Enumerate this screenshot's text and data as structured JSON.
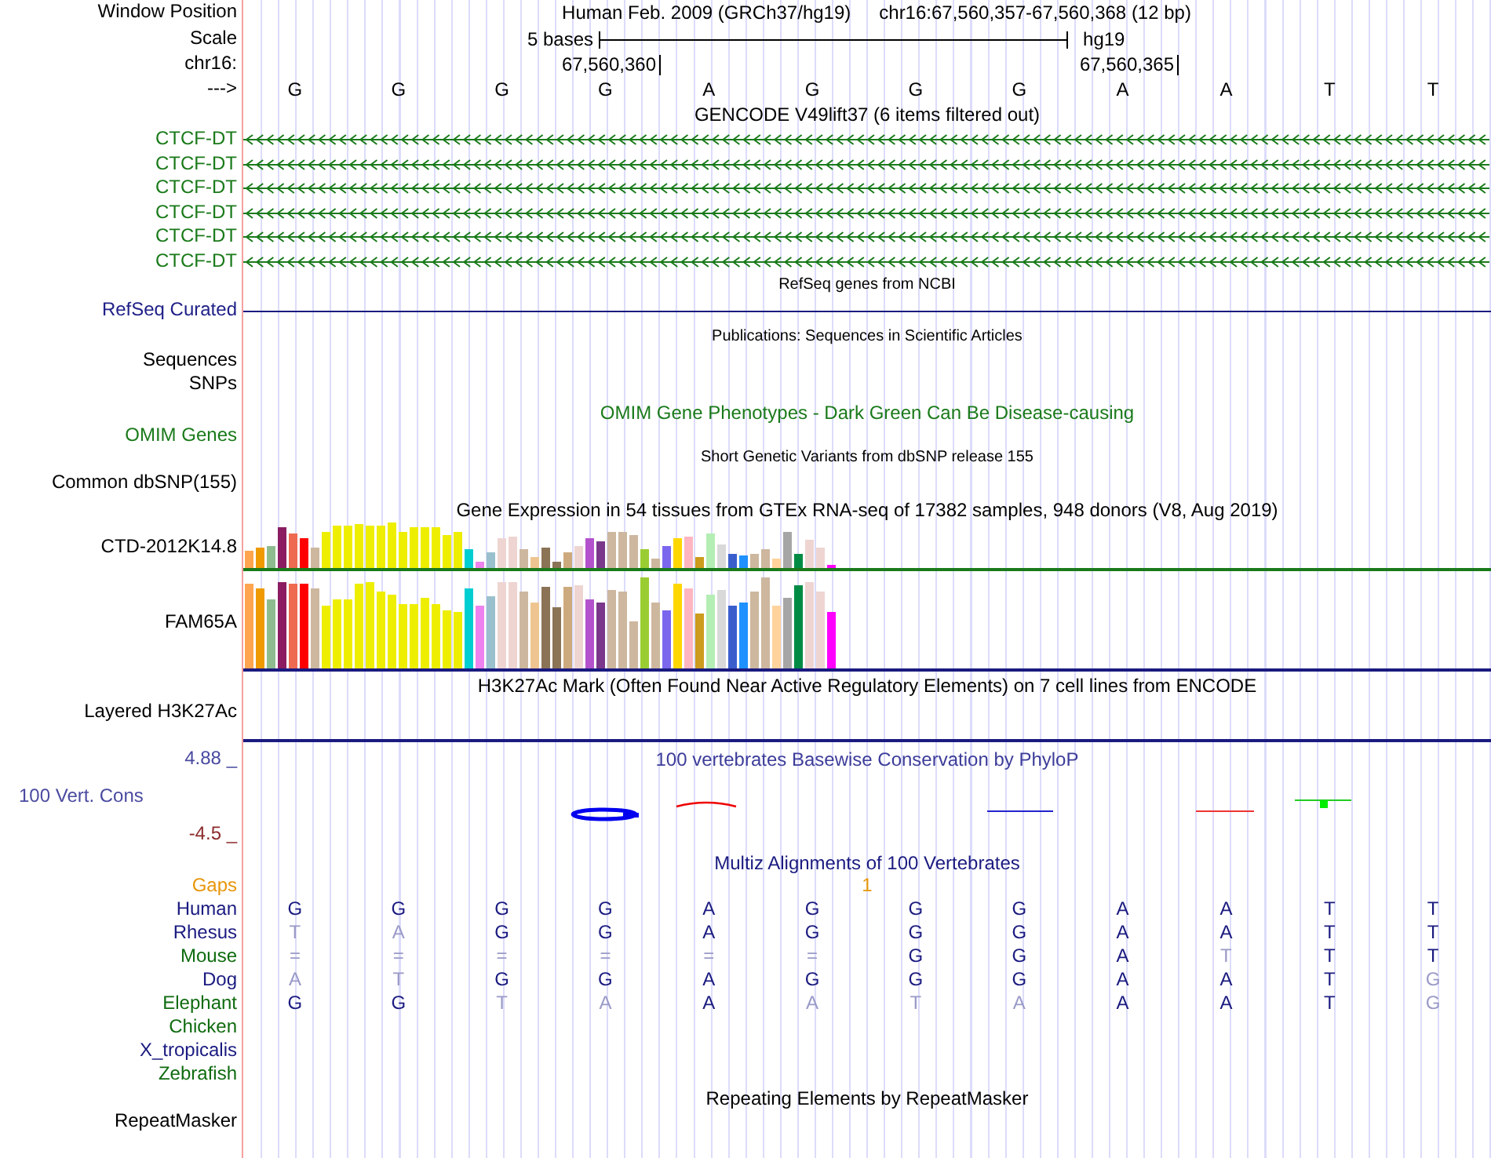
{
  "header": {
    "label": "Window Position",
    "assembly": "Human Feb. 2009 (GRCh37/hg19)",
    "position": "chr16:67,560,357-67,560,368 (12 bp)"
  },
  "scale": {
    "label": "Scale",
    "span": "5 bases",
    "db": "hg19"
  },
  "coords": {
    "label": "chr16:",
    "ticks": [
      "67,560,360",
      "67,560,365"
    ]
  },
  "sequence": {
    "label": "--->",
    "bases": [
      "G",
      "G",
      "G",
      "G",
      "A",
      "G",
      "G",
      "G",
      "A",
      "A",
      "T",
      "T"
    ]
  },
  "gencode": {
    "title": "GENCODE V49lift37 (6 items filtered out)",
    "transcripts": [
      "CTCF-DT",
      "CTCF-DT",
      "CTCF-DT",
      "CTCF-DT",
      "CTCF-DT",
      "CTCF-DT"
    ]
  },
  "refseq": {
    "title": "RefSeq genes from NCBI",
    "label": "RefSeq Curated"
  },
  "publications": {
    "title": "Publications: Sequences in Scientific Articles",
    "labels": [
      "Sequences",
      "SNPs"
    ]
  },
  "omim": {
    "title": "OMIM Gene Phenotypes - Dark Green Can Be Disease-causing",
    "label": "OMIM Genes"
  },
  "dbsnp": {
    "title": "Short Genetic Variants from dbSNP release 155",
    "label": "Common dbSNP(155)"
  },
  "gtex": {
    "title": "Gene Expression in 54 tissues from GTEx RNA-seq of 17382 samples, 948 donors (V8, Aug 2019)",
    "genes": [
      {
        "name": "CTD-2012K14.8",
        "kind": "small"
      },
      {
        "name": "FAM65A",
        "kind": "large"
      }
    ]
  },
  "h3k27ac": {
    "title": "H3K27Ac Mark (Often Found Near Active Regulatory Elements) on 7 cell lines from ENCODE",
    "label": "Layered H3K27Ac"
  },
  "conservation": {
    "title": "100 vertebrates Basewise Conservation by PhyloP",
    "label": "100 Vert. Cons",
    "max": "4.88 _",
    "min": "-4.5 _"
  },
  "multiz": {
    "title": "Multiz Alignments of 100 Vertebrates",
    "gaps_label": "Gaps",
    "gap_count": "1",
    "species": [
      {
        "name": "Human",
        "color": "#1a1a80",
        "bases": [
          {
            "b": "G",
            "faded": false
          },
          {
            "b": "G",
            "faded": false
          },
          {
            "b": "G",
            "faded": false
          },
          {
            "b": "G",
            "faded": false
          },
          {
            "b": "A",
            "faded": false
          },
          {
            "b": "G",
            "faded": false
          },
          {
            "b": "G",
            "faded": false
          },
          {
            "b": "G",
            "faded": false
          },
          {
            "b": "A",
            "faded": false
          },
          {
            "b": "A",
            "faded": false
          },
          {
            "b": "T",
            "faded": false
          },
          {
            "b": "T",
            "faded": false
          }
        ]
      },
      {
        "name": "Rhesus",
        "color": "#1a1a80",
        "bases": [
          {
            "b": "T",
            "faded": true
          },
          {
            "b": "A",
            "faded": true
          },
          {
            "b": "G",
            "faded": false
          },
          {
            "b": "G",
            "faded": false
          },
          {
            "b": "A",
            "faded": false
          },
          {
            "b": "G",
            "faded": false
          },
          {
            "b": "G",
            "faded": false
          },
          {
            "b": "G",
            "faded": false
          },
          {
            "b": "A",
            "faded": false
          },
          {
            "b": "A",
            "faded": false
          },
          {
            "b": "T",
            "faded": false
          },
          {
            "b": "T",
            "faded": false
          }
        ]
      },
      {
        "name": "Mouse",
        "color": "#0f6b0f",
        "bases": [
          {
            "b": "=",
            "faded": true
          },
          {
            "b": "=",
            "faded": true
          },
          {
            "b": "=",
            "faded": true
          },
          {
            "b": "=",
            "faded": true
          },
          {
            "b": "=",
            "faded": true
          },
          {
            "b": "=",
            "faded": true
          },
          {
            "b": "G",
            "faded": false
          },
          {
            "b": "G",
            "faded": false
          },
          {
            "b": "A",
            "faded": false
          },
          {
            "b": "T",
            "faded": true
          },
          {
            "b": "T",
            "faded": false
          },
          {
            "b": "T",
            "faded": false
          }
        ]
      },
      {
        "name": "Dog",
        "color": "#1a1a80",
        "bases": [
          {
            "b": "A",
            "faded": true
          },
          {
            "b": "T",
            "faded": true
          },
          {
            "b": "G",
            "faded": false
          },
          {
            "b": "G",
            "faded": false
          },
          {
            "b": "A",
            "faded": false
          },
          {
            "b": "G",
            "faded": false
          },
          {
            "b": "G",
            "faded": false
          },
          {
            "b": "G",
            "faded": false
          },
          {
            "b": "A",
            "faded": false
          },
          {
            "b": "A",
            "faded": false
          },
          {
            "b": "T",
            "faded": false
          },
          {
            "b": "G",
            "faded": true
          }
        ]
      },
      {
        "name": "Elephant",
        "color": "#0f6b0f",
        "bases": [
          {
            "b": "G",
            "faded": false
          },
          {
            "b": "G",
            "faded": false
          },
          {
            "b": "T",
            "faded": true
          },
          {
            "b": "A",
            "faded": true
          },
          {
            "b": "A",
            "faded": false
          },
          {
            "b": "A",
            "faded": true
          },
          {
            "b": "T",
            "faded": true
          },
          {
            "b": "A",
            "faded": true
          },
          {
            "b": "A",
            "faded": false
          },
          {
            "b": "A",
            "faded": false
          },
          {
            "b": "T",
            "faded": false
          },
          {
            "b": "G",
            "faded": true
          }
        ]
      },
      {
        "name": "Chicken",
        "color": "#0f6b0f"
      },
      {
        "name": "X_tropicalis",
        "color": "#1a1a80"
      },
      {
        "name": "Zebrafish",
        "color": "#0f6b0f"
      }
    ]
  },
  "repeatmasker": {
    "title": "Repeating Elements by RepeatMasker",
    "label": "RepeatMasker"
  }
}
